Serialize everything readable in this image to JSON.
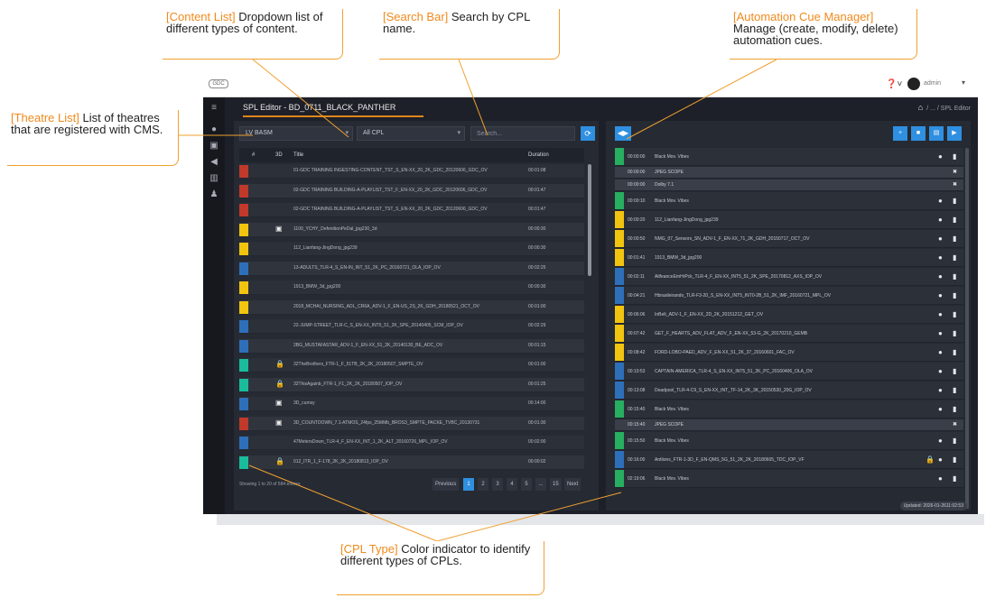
{
  "callouts": {
    "theatre_list": {
      "tag": "[Theatre List]",
      "text": " List of theatres that are registered with CMS."
    },
    "content_list": {
      "tag": "[Content List]",
      "text": " Dropdown list of different types of content."
    },
    "search_bar": {
      "tag": "[Search Bar]",
      "text": " Search by CPL name."
    },
    "automation_cue": {
      "tag": "[Automation Cue Manager]",
      "text": " Manage (create, modify, delete) automation cues."
    },
    "cpl_type": {
      "tag": "[CPL Type]",
      "text": " Color indicator to identify different types of CPLs."
    }
  },
  "app": {
    "logo": "GDC",
    "help_label": "❓˅",
    "user_name": "admin",
    "title": "SPL Editor - BD_0711_BLACK_PANTHER",
    "breadcrumb": "/ ... / SPL Editor"
  },
  "left_panel": {
    "theatre_select": "LV BASM",
    "content_select": "All CPL",
    "search_placeholder": "Search...",
    "columns": {
      "col_num": "#",
      "col_3d": "3D",
      "col_title": "Title",
      "col_duration": "Duration"
    },
    "showing": "Showing 1 to 20 of 584 entries",
    "pager": {
      "prev": "Previous",
      "pages": [
        "1",
        "2",
        "3",
        "4",
        "5",
        "...",
        "15"
      ],
      "next": "Next"
    },
    "rows": [
      {
        "type_color": "#c0392b",
        "icon": "",
        "title": "01-GDC TRAINING INGESTING-CONTENT_TST_S_EN-XX_20_2K_GDC_20120606_GDC_OV",
        "duration": "00:01:08"
      },
      {
        "type_color": "#c0392b",
        "icon": "",
        "title": "02-GDC TRAINING BUILDING-A-PLAYLIST_TST_F_EN-XX_20_2K_GDC_20120606_GDC_OV",
        "duration": "00:01:47"
      },
      {
        "type_color": "#c0392b",
        "icon": "",
        "title": "02-GDC TRAINING BUILDING-A-PLAYLIST_TST_S_EN-XX_20_2K_GDC_20120606_GDC_OV",
        "duration": "00:01:47"
      },
      {
        "type_color": "#f1c40f",
        "icon": "▣",
        "title": "1100_YCHY_DefenitionPeDal_jpg230_3d",
        "duration": "00:00:30"
      },
      {
        "type_color": "#f1c40f",
        "icon": "",
        "title": "112_Lianfang-JingDong_jpg239",
        "duration": "00:00:30"
      },
      {
        "type_color": "#2e6fba",
        "icon": "",
        "title": "13-ADULTS_TLR-4_S_EN-IN_INT_51_2K_PC_20160721_OLA_IOP_OV",
        "duration": "00:02:25"
      },
      {
        "type_color": "#f1c40f",
        "icon": "",
        "title": "1913_BMW_3d_jpg200",
        "duration": "00:00:30"
      },
      {
        "type_color": "#f1c40f",
        "icon": "",
        "title": "2018_MCHAI_NURSING_ADL_CR6A_ADV-1_F_EN-US_2S_2K_GDH_20180521_OCT_OV",
        "duration": "00:01:00"
      },
      {
        "type_color": "#2e6fba",
        "icon": "",
        "title": "22-JUMP-STREET_TLR-C_S_EN-XX_INT5_51_2K_SPE_20140405_SCM_IOP_OV",
        "duration": "00:02:29"
      },
      {
        "type_color": "#2e6fba",
        "icon": "",
        "title": "2BG_MUSTAFASTAR_ADV-1_F_EN-XX_51_2K_20140130_BE_ADC_OV",
        "duration": "00:01:15"
      },
      {
        "type_color": "#1abc9c",
        "icon": "🔒",
        "title": "32TheBrothers_FTR-1_F_51TB_2K_2K_20180507_SMPTE_OV",
        "duration": "00:01:00"
      },
      {
        "type_color": "#1abc9c",
        "icon": "🔒",
        "title": "32ThisAgainb_FTR-1_F1_2K_2K_20180507_IOP_OV",
        "duration": "00:01:25"
      },
      {
        "type_color": "#2e6fba",
        "icon": "▣",
        "title": "3D_cumsy",
        "duration": "00:14:00"
      },
      {
        "type_color": "#c0392b",
        "icon": "▣",
        "title": "3D_COUNTDOWN_7.1-ATMOS_24fps_25MMb_BROS3_SMPTE_PACKE_TVBC_20130731",
        "duration": "00:01:30"
      },
      {
        "type_color": "#2e6fba",
        "icon": "",
        "title": "47MetersDown_TLR-4_F_EN-XX_INT_1_2K_ALT_20160726_MPL_IOP_OV",
        "duration": "00:02:00"
      },
      {
        "type_color": "#1abc9c",
        "icon": "🔒",
        "title": "012_ITR_1_F-178_2K_2K_20180813_IOP_OV",
        "duration": "00:00:02"
      }
    ]
  },
  "right_panel": {
    "cue_button": "◀▶",
    "actions": [
      "+",
      "■",
      "▤",
      "▶"
    ],
    "updated": "Updated: 2026-01-2611:02:53",
    "cues": [
      {
        "color": "#27ae60",
        "time": "00:00:00",
        "name": "Black Mov. Vibes",
        "sub": false,
        "lock": false
      },
      {
        "color": "",
        "time": "00:00:00",
        "name": "JPEG SCOPE",
        "sub": true,
        "lock": false
      },
      {
        "color": "",
        "time": "00:00:00",
        "name": "Dolby 7.1",
        "sub": true,
        "lock": false
      },
      {
        "color": "#27ae60",
        "time": "00:00:10",
        "name": "Black Mov. Vibes",
        "sub": false,
        "lock": false
      },
      {
        "color": "#f1c40f",
        "time": "00:00:20",
        "name": "112_Lianfang-JingDong_jpg239",
        "sub": false,
        "lock": false
      },
      {
        "color": "#f1c40f",
        "time": "00:00:50",
        "name": "NMG_07_Sensors_SN_ADV-1_F_EN-XX_71_2K_GDH_20150717_OCT_OV",
        "sub": false,
        "lock": false
      },
      {
        "color": "#f1c40f",
        "time": "00:01:41",
        "name": "1913_BMW_3d_jpg200",
        "sub": false,
        "lock": false
      },
      {
        "color": "#2e6fba",
        "time": "00:02:11",
        "name": "AlifeanceEmHrPck_TLR-4_F_EN-XX_INT5_51_2K_SPE_20170812_AXS_IOP_OV",
        "sub": false,
        "lock": false
      },
      {
        "color": "#2e6fba",
        "time": "00:04:21",
        "name": "Hbrasileirando_TLR-F3-20_S_EN-XX_INT5_INT0-2B_51_2K_IMF_20160721_MPL_OV",
        "sub": false,
        "lock": false
      },
      {
        "color": "#f1c40f",
        "time": "00:06:06",
        "name": "InBelt_ADV-1_F_EN-XX_2D_2K_20151212_GET_OV",
        "sub": false,
        "lock": false
      },
      {
        "color": "#f1c40f",
        "time": "00:07:42",
        "name": "GET_F_HEARTS_ADV_FLAT_ADV_F_EN-XX_53-G_2K_20170210_GEMB",
        "sub": false,
        "lock": false
      },
      {
        "color": "#f1c40f",
        "time": "00:08:42",
        "name": "FORD-LOBO-PAED_ADV_F_EN-XX_51_2K_37_20160601_FAC_OV",
        "sub": false,
        "lock": false
      },
      {
        "color": "#2e6fba",
        "time": "00:10:53",
        "name": "CAPTAIN-AMERICA_TLR-4_S_EN-XX_INT5_51_2K_PC_20160406_OLA_OV",
        "sub": false,
        "lock": false
      },
      {
        "color": "#2e6fba",
        "time": "00:13:08",
        "name": "Deadpool_TLR-4-C9_S_EN-XX_INT_TF-14_2K_3K_20150530_20G_IOP_OV",
        "sub": false,
        "lock": false
      },
      {
        "color": "#27ae60",
        "time": "00:15:40",
        "name": "Black Mov. Vibes",
        "sub": false,
        "lock": false
      },
      {
        "color": "",
        "time": "00:15:40",
        "name": "JPEG SCOPE",
        "sub": true,
        "lock": false
      },
      {
        "color": "#27ae60",
        "time": "00:15:50",
        "name": "Black Mov. Vibes",
        "sub": false,
        "lock": false
      },
      {
        "color": "#2e6fba",
        "time": "00:16:00",
        "name": "Antlions_FTR-1-3D_F_EN-QMS_5G_51_2K_2K_20180605_TDC_IOP_VF",
        "sub": false,
        "lock": true
      },
      {
        "color": "#27ae60",
        "time": "02:19:06",
        "name": "Black Mov. Vibes",
        "sub": false,
        "lock": false
      }
    ]
  },
  "colors": {
    "accent": "#e0861c",
    "primary": "#2f8fe0",
    "callout_tag": "#f08a1c"
  }
}
